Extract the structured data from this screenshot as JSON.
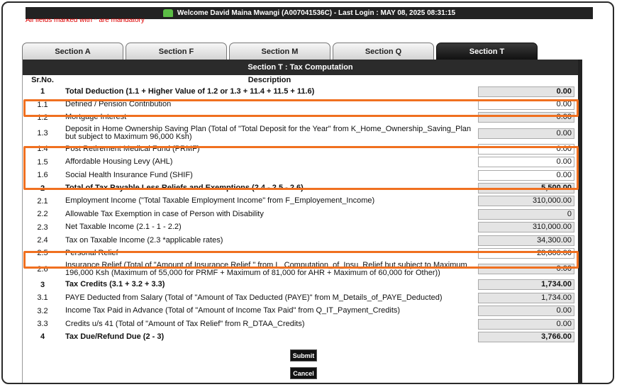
{
  "header": {
    "welcome": "Welcome David Maina Mwangi (A007041536C)  - Last Login : MAY 08, 2025 08:31:15",
    "mandatory_note": "All fields marked with * are mandatory"
  },
  "tabs": [
    {
      "label": "Section A"
    },
    {
      "label": "Section F"
    },
    {
      "label": "Section M"
    },
    {
      "label": "Section Q"
    },
    {
      "label": "Section T"
    }
  ],
  "section": {
    "title": "Section T : Tax Computation",
    "col_srno": "Sr.No.",
    "col_desc": "Description"
  },
  "rows": [
    {
      "sr": "1",
      "desc": "Total Deduction (1.1 + Higher Value of 1.2 or 1.3 + 11.4 + 11.5 + 11.6)",
      "value": "0.00"
    },
    {
      "sr": "1.1",
      "desc": "Defined / Pension Contribution",
      "value": "0.00"
    },
    {
      "sr": "1.2",
      "desc": "Mortgage Interest",
      "value": "0.00"
    },
    {
      "sr": "1.3",
      "desc": "Deposit in Home Ownership Saving Plan (Total of \"Total Deposit for the Year\" from K_Home_Ownership_Saving_Plan but subject to Maximum 96,000 Ksh)",
      "value": "0.00"
    },
    {
      "sr": "1.4",
      "desc": "Post Retirement Medical Fund (PRMF)",
      "value": "0.00"
    },
    {
      "sr": "1.5",
      "desc": "Affordable Housing Levy (AHL)",
      "value": "0.00"
    },
    {
      "sr": "1.6",
      "desc": "Social Health Insurance Fund (SHIF)",
      "value": "0.00"
    },
    {
      "sr": "2",
      "desc": "Total of Tax Payable Less Reliefs and Exemptions (2.4 - 2.5 - 2.6)",
      "value": "5,500.00"
    },
    {
      "sr": "2.1",
      "desc": "Employment Income (\"Total Taxable Employment Income\" from F_Employement_Income)",
      "value": "310,000.00"
    },
    {
      "sr": "2.2",
      "desc": "Allowable Tax Exemption in case of Person with Disability",
      "value": "0"
    },
    {
      "sr": "2.3",
      "desc": "Net Taxable Income (2.1 - 1 - 2.2)",
      "value": "310,000.00"
    },
    {
      "sr": "2.4",
      "desc": "Tax on Taxable Income (2.3 *applicable rates)",
      "value": "34,300.00"
    },
    {
      "sr": "2.5",
      "desc": "Personal Relief",
      "value": "28,800.00"
    },
    {
      "sr": "2.6",
      "desc": "Insurance Relief (Total of \"Amount of Insurance Relief \" from L_Computation_of_Insu_Relief but subject to Maximum 196,000 Ksh (Maximum of 55,000 for PRMF + Maximum of 81,000 for AHR + Maximum of 60,000 for Other))",
      "value": "0.00"
    },
    {
      "sr": "3",
      "desc": "Tax Credits (3.1 + 3.2 + 3.3)",
      "value": "1,734.00"
    },
    {
      "sr": "3.1",
      "desc": "PAYE Deducted from Salary (Total of \"Amount of Tax Deducted (PAYE)\" from M_Details_of_PAYE_Deducted)",
      "value": "1,734.00"
    },
    {
      "sr": "3.2",
      "desc": "Income Tax Paid in Advance (Total of \"Amount of Income Tax Paid\" from Q_IT_Payment_Credits)",
      "value": "0.00"
    },
    {
      "sr": "3.3",
      "desc": "Credits u/s 41 (Total of \"Amount of Tax Relief\" from R_DTAA_Credits)",
      "value": "0.00"
    },
    {
      "sr": "4",
      "desc": "Tax Due/Refund Due (2 - 3)",
      "value": "3,766.00"
    }
  ],
  "buttons": {
    "submit": "Submit",
    "cancel": "Cancel"
  },
  "highlight_color": "#f07020"
}
